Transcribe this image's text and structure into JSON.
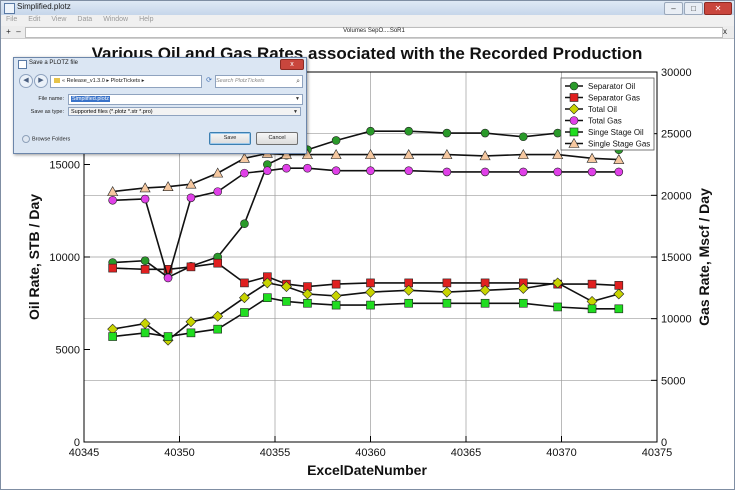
{
  "window": {
    "title": "Simplified.plotz",
    "controls": [
      "–",
      "□",
      "✕"
    ]
  },
  "menu": [
    "File",
    "Edit",
    "View",
    "Data",
    "Window",
    "Help"
  ],
  "tabbar": {
    "add": "+",
    "back": "–",
    "tab_label": "Volumes SepO....SoR1",
    "close": "x"
  },
  "dialog": {
    "title": "Save a PLOTZ file",
    "close": "x",
    "breadcrumb": "« Release_v1.3.0 ▸ PlotzTickets ▸",
    "search_placeholder": "Search PlotzTickets",
    "file_name_label": "File name:",
    "file_name_value": "Simplified.plotz",
    "save_type_label": "Save as type:",
    "save_type_value": "Supported files (*.plotz *.str *.pro)",
    "browse_label": "Browse Folders",
    "save_button": "Save",
    "cancel_button": "Cancel"
  },
  "colors": {
    "separator_oil": "#2a9a2a",
    "separator_gas": "#e02020",
    "total_oil": "#c8d400",
    "total_gas": "#e040e8",
    "single_stage_oil": "#20dd20",
    "single_stage_gas": "#f6c8a0"
  },
  "chart_data": {
    "type": "line",
    "title": "Various Oil and Gas Rates associated with the Recorded Production",
    "xlabel": "ExcelDateNumber",
    "ylabel": "Oil Rate, STB / Day",
    "y2label": "Gas Rate, Mscf / Day",
    "xlim": [
      40345,
      40375
    ],
    "ylim": [
      0,
      20000
    ],
    "y2lim": [
      0,
      30000
    ],
    "x_ticks": [
      40345,
      40350,
      40355,
      40360,
      40365,
      40370,
      40375
    ],
    "y_ticks": [
      0,
      5000,
      10000,
      15000
    ],
    "y2_ticks": [
      0,
      5000,
      10000,
      15000,
      20000,
      25000,
      30000
    ],
    "grid": true,
    "legend": "top-right",
    "series": [
      {
        "name": "Separator Oil",
        "axis": "left",
        "marker": "circle",
        "color": "#2a9a2a",
        "x": [
          40346.5,
          40348.2,
          40349.4,
          40350.6,
          40352.0,
          40353.4,
          40354.6,
          40355.6,
          40356.7,
          40358.2,
          40360.0,
          40362.0,
          40364.0,
          40366.0,
          40368.0,
          40369.8,
          40371.6,
          40373.0
        ],
        "y": [
          9700,
          9800,
          8900,
          9500,
          10000,
          11800,
          15000,
          15500,
          15800,
          16300,
          16800,
          16800,
          16700,
          16700,
          16500,
          16700,
          16100,
          15800
        ]
      },
      {
        "name": "Separator Gas",
        "axis": "right",
        "marker": "square",
        "color": "#e02020",
        "x": [
          40346.5,
          40348.2,
          40349.4,
          40350.6,
          40352.0,
          40353.4,
          40354.6,
          40355.6,
          40356.7,
          40358.2,
          40360.0,
          40362.0,
          40364.0,
          40366.0,
          40368.0,
          40369.8,
          40371.6,
          40373.0
        ],
        "y": [
          14100,
          14000,
          14000,
          14200,
          14500,
          12900,
          13400,
          12800,
          12600,
          12800,
          12900,
          12900,
          12900,
          12900,
          12900,
          12800,
          12800,
          12700
        ]
      },
      {
        "name": "Total Oil",
        "axis": "left",
        "marker": "diamond",
        "color": "#c8d400",
        "x": [
          40346.5,
          40348.2,
          40349.4,
          40350.6,
          40352.0,
          40353.4,
          40354.6,
          40355.6,
          40356.7,
          40358.2,
          40360.0,
          40362.0,
          40364.0,
          40366.0,
          40368.0,
          40369.8,
          40371.6,
          40373.0
        ],
        "y": [
          6100,
          6400,
          5500,
          6500,
          6800,
          7800,
          8600,
          8400,
          8000,
          7900,
          8100,
          8200,
          8100,
          8200,
          8300,
          8600,
          7600,
          8000
        ]
      },
      {
        "name": "Total Gas",
        "axis": "right",
        "marker": "circle",
        "color": "#e040e8",
        "x": [
          40346.5,
          40348.2,
          40349.4,
          40350.6,
          40352.0,
          40353.4,
          40354.6,
          40355.6,
          40356.7,
          40358.2,
          40360.0,
          40362.0,
          40364.0,
          40366.0,
          40368.0,
          40369.8,
          40371.6,
          40373.0
        ],
        "y": [
          19600,
          19700,
          13300,
          19800,
          20300,
          21800,
          22000,
          22200,
          22200,
          22000,
          22000,
          22000,
          21900,
          21900,
          21900,
          21900,
          21900,
          21900
        ]
      },
      {
        "name": "Singe Stage Oil",
        "axis": "left",
        "marker": "square",
        "color": "#20dd20",
        "x": [
          40346.5,
          40348.2,
          40349.4,
          40350.6,
          40352.0,
          40353.4,
          40354.6,
          40355.6,
          40356.7,
          40358.2,
          40360.0,
          40362.0,
          40364.0,
          40366.0,
          40368.0,
          40369.8,
          40371.6,
          40373.0
        ],
        "y": [
          5700,
          5900,
          5700,
          5900,
          6100,
          7000,
          7800,
          7600,
          7500,
          7400,
          7400,
          7500,
          7500,
          7500,
          7500,
          7300,
          7200,
          7200
        ]
      },
      {
        "name": "Single Stage Gas",
        "axis": "right",
        "marker": "triangle",
        "color": "#f6c8a0",
        "x": [
          40346.5,
          40348.2,
          40349.4,
          40350.6,
          40352.0,
          40353.4,
          40354.6,
          40355.6,
          40356.7,
          40358.2,
          40360.0,
          40362.0,
          40364.0,
          40366.0,
          40368.0,
          40369.8,
          40371.6,
          40373.0
        ],
        "y": [
          20300,
          20600,
          20700,
          20900,
          21800,
          23000,
          23400,
          23300,
          23300,
          23300,
          23300,
          23300,
          23300,
          23200,
          23300,
          23300,
          23000,
          22900
        ]
      }
    ]
  }
}
